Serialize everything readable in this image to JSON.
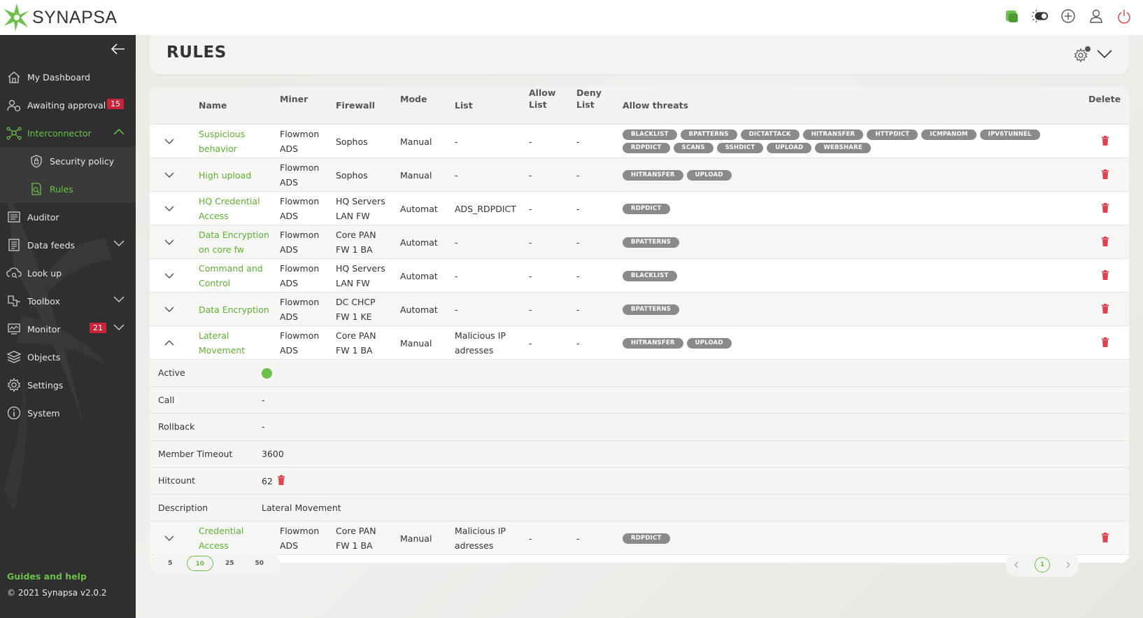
{
  "app": {
    "logo_text": "SYNAPSA"
  },
  "sidebar": {
    "items": [
      {
        "label": "My Dashboard",
        "icon": "home-icon"
      },
      {
        "label": "Awaiting approval",
        "icon": "approval-icon",
        "badge": "15"
      },
      {
        "label": "Interconnector",
        "icon": "interconnector-icon",
        "active": true
      },
      {
        "label": "Security policy",
        "icon": "shield-icon"
      },
      {
        "label": "Rules",
        "icon": "rules-icon",
        "active": true
      },
      {
        "label": "Auditor",
        "icon": "auditor-icon"
      },
      {
        "label": "Data feeds",
        "icon": "data-feeds-icon"
      },
      {
        "label": "Look up",
        "icon": "cloud-search-icon"
      },
      {
        "label": "Toolbox",
        "icon": "toolbox-icon"
      },
      {
        "label": "Monitor",
        "icon": "monitor-icon",
        "badge": "21"
      },
      {
        "label": "Objects",
        "icon": "layers-icon"
      },
      {
        "label": "Settings",
        "icon": "gear-icon"
      },
      {
        "label": "System",
        "icon": "info-icon"
      }
    ],
    "guides": "Guides and help",
    "copyright": "© 2021 Synapsa v2.0.2"
  },
  "page": {
    "title": "RULES"
  },
  "table": {
    "headers": {
      "name": "Name",
      "miner": "Miner",
      "firewall": "Firewall",
      "mode": "Mode",
      "list": "List",
      "allow_list_1": "Allow",
      "allow_list_2": "List",
      "deny_list_1": "Deny",
      "deny_list_2": "List",
      "allow_threats": "Allow threats",
      "delete": "Delete"
    },
    "rows": [
      {
        "name1": "Suspicious",
        "name2": "behavior",
        "miner1": "Flowmon",
        "miner2": "ADS",
        "fw1": "Sophos",
        "fw2": "",
        "mode": "Manual",
        "list1": "-",
        "list2": "",
        "allow": "-",
        "deny": "-",
        "threats": [
          "BLACKLIST",
          "BPATTERNS",
          "DICTATTACK",
          "HITRANSFER",
          "HTTPDICT",
          "ICMPANOM",
          "IPV6TUNNEL",
          "RDPDICT",
          "SCANS",
          "SSHDICT",
          "UPLOAD",
          "WEBSHARE"
        ]
      },
      {
        "name1": "High upload",
        "name2": "",
        "miner1": "Flowmon",
        "miner2": "ADS",
        "fw1": "Sophos",
        "fw2": "",
        "mode": "Manual",
        "list1": "-",
        "list2": "",
        "allow": "-",
        "deny": "-",
        "threats": [
          "HITRANSFER",
          "UPLOAD"
        ]
      },
      {
        "name1": "HQ Credential",
        "name2": "Access",
        "miner1": "Flowmon",
        "miner2": "ADS",
        "fw1": "HQ Servers",
        "fw2": "LAN FW",
        "mode": "Automat",
        "list1": "ADS_RDPDICT",
        "list2": "",
        "allow": "-",
        "deny": "-",
        "threats": [
          "RDPDICT"
        ]
      },
      {
        "name1": "Data Encryption",
        "name2": "on core fw",
        "miner1": "Flowmon",
        "miner2": "ADS",
        "fw1": "Core PAN",
        "fw2": "FW 1 BA",
        "mode": "Automat",
        "list1": "-",
        "list2": "",
        "allow": "-",
        "deny": "-",
        "threats": [
          "BPATTERNS"
        ]
      },
      {
        "name1": "Command and",
        "name2": "Control",
        "miner1": "Flowmon",
        "miner2": "ADS",
        "fw1": "HQ Servers",
        "fw2": "LAN FW",
        "mode": "Automat",
        "list1": "-",
        "list2": "",
        "allow": "-",
        "deny": "-",
        "threats": [
          "BLACKLIST"
        ]
      },
      {
        "name1": "Data Encryption",
        "name2": "",
        "miner1": "Flowmon",
        "miner2": "ADS",
        "fw1": "DC CHCP",
        "fw2": "FW 1 KE",
        "mode": "Automat",
        "list1": "-",
        "list2": "",
        "allow": "-",
        "deny": "-",
        "threats": [
          "BPATTERNS"
        ]
      },
      {
        "name1": "Lateral",
        "name2": "Movement",
        "miner1": "Flowmon",
        "miner2": "ADS",
        "fw1": "Core PAN",
        "fw2": "FW 1 BA",
        "mode": "Manual",
        "list1": "Malicious IP",
        "list2": "adresses",
        "allow": "-",
        "deny": "-",
        "threats": [
          "HITRANSFER",
          "UPLOAD"
        ],
        "expanded": true
      },
      {
        "name1": "Credential",
        "name2": "Access",
        "miner1": "Flowmon",
        "miner2": "ADS",
        "fw1": "Core PAN",
        "fw2": "FW 1 BA",
        "mode": "Manual",
        "list1": "Malicious IP",
        "list2": "adresses",
        "allow": "-",
        "deny": "-",
        "threats": [
          "RDPDICT"
        ]
      }
    ],
    "detail": {
      "active_label": "Active",
      "call_label": "Call",
      "call_value": "-",
      "rollback_label": "Rollback",
      "rollback_value": "-",
      "timeout_label": "Member Timeout",
      "timeout_value": "3600",
      "hitcount_label": "Hitcount",
      "hitcount_value": "62",
      "description_label": "Description",
      "description_value": "Lateral Movement"
    }
  },
  "pagination": {
    "sizes": [
      "5",
      "10",
      "25",
      "50"
    ],
    "selected_size": "10",
    "current_page": "1"
  },
  "colors": {
    "accent": "#6dc04b",
    "danger": "#e0434f",
    "sidebar": "#2f2f2f",
    "badge": "#c8243a"
  }
}
